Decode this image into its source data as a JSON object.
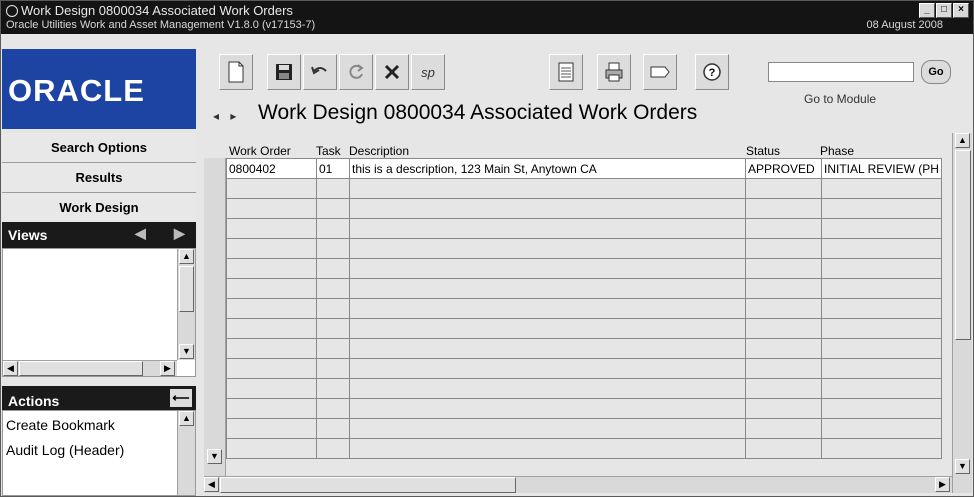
{
  "window": {
    "title": "Work Design 0800034 Associated Work Orders",
    "subtitle": "Oracle Utilities Work and Asset Management V1.8.0 (v17153-7)",
    "date": "08 August  2008",
    "controls": [
      "_",
      "□",
      "×"
    ]
  },
  "logo": {
    "text": "ORACLE"
  },
  "toolbar": {
    "buttons": [
      {
        "name": "new-document-icon",
        "glyph": "🗋"
      },
      {
        "name": "save-icon",
        "glyph": "💾"
      },
      {
        "name": "undo-icon",
        "glyph": "↶"
      },
      {
        "name": "refresh-icon",
        "glyph": "⟳"
      },
      {
        "name": "delete-icon",
        "glyph": "✕"
      },
      {
        "name": "spell-check-icon",
        "glyph": "sp"
      },
      {
        "name": "report-icon",
        "glyph": "▤"
      },
      {
        "name": "print-icon",
        "glyph": "⎙"
      },
      {
        "name": "tag-icon",
        "glyph": "⌸"
      },
      {
        "name": "help-icon",
        "glyph": "?"
      }
    ],
    "goto_label": "Go to Module",
    "go_button": "Go",
    "goto_value": ""
  },
  "page_title": "Work Design 0800034 Associated Work Orders",
  "sidebar": {
    "nav": [
      "Search Options",
      "Results",
      "Work Design"
    ],
    "views_label": "Views",
    "actions_label": "Actions",
    "actions": [
      "Create Bookmark",
      "Audit Log (Header)"
    ]
  },
  "grid": {
    "headers": [
      "Work Order",
      "Task",
      "Description",
      "Status",
      "Phase"
    ],
    "rows": [
      [
        "0800402",
        "01",
        "this is a description, 123 Main St, Anytown CA",
        "APPROVED",
        "INITIAL REVIEW (PH"
      ]
    ],
    "empty_rows": 14
  }
}
